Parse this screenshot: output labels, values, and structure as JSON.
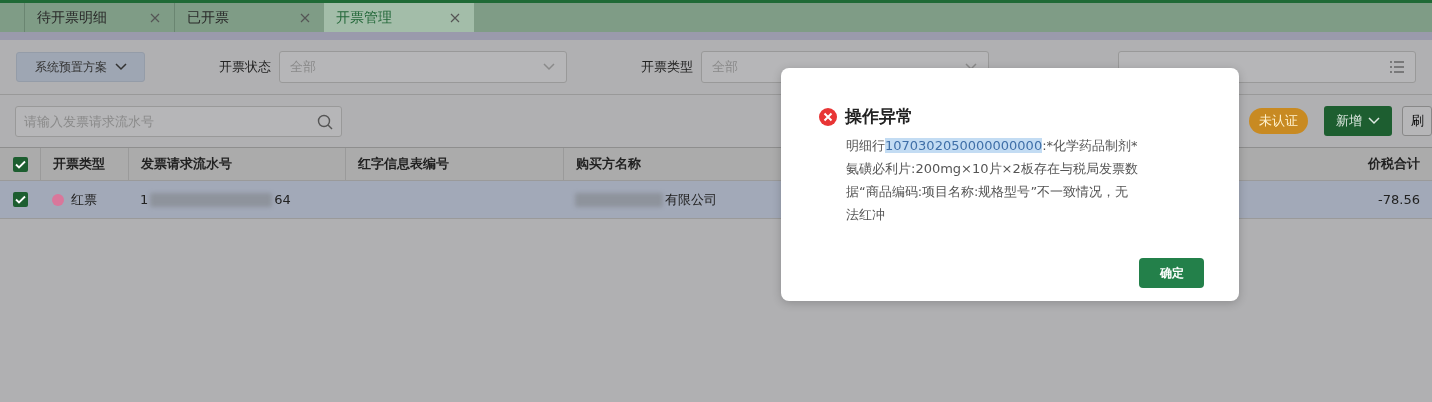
{
  "tabs": [
    {
      "label": "待开票明细",
      "selected": false
    },
    {
      "label": "已开票",
      "selected": false
    },
    {
      "label": "开票管理",
      "selected": true
    }
  ],
  "filters": {
    "scheme_button": "系统预置方案",
    "fields": [
      {
        "label": "开票状态",
        "placeholder": "全部",
        "kind": "select"
      },
      {
        "label": "开票类型",
        "placeholder": "全部",
        "kind": "select"
      },
      {
        "kind": "list"
      }
    ]
  },
  "toolbar": {
    "search": {
      "placeholder": "请输入发票请求流水号"
    },
    "badge": "未认证",
    "add_button": "新增",
    "edge_button": "刷"
  },
  "table": {
    "all_checked": true,
    "columns": [
      "开票类型",
      "发票请求流水号",
      "红字信息表编号",
      "购买方名称",
      "价税合计"
    ],
    "rows": [
      {
        "checked": true,
        "selected": true,
        "type": "红票",
        "color": "#d9779b",
        "serial_start": "1",
        "serial_end": "64",
        "buyer_visible": "有限公司",
        "total": "-78.56"
      }
    ]
  },
  "dialog": {
    "title": "操作异常",
    "message_before": "明细行",
    "message_selected": "1070302050000000000",
    "message_after": [
      ":*化学药品制剂*",
      "氨磺必利片:200mg×10片×2板存在与税局发票数",
      "据“商品编码:项目名称:规格型号”不一致情况，无",
      "法红冲"
    ],
    "ok_button": "确定"
  }
}
